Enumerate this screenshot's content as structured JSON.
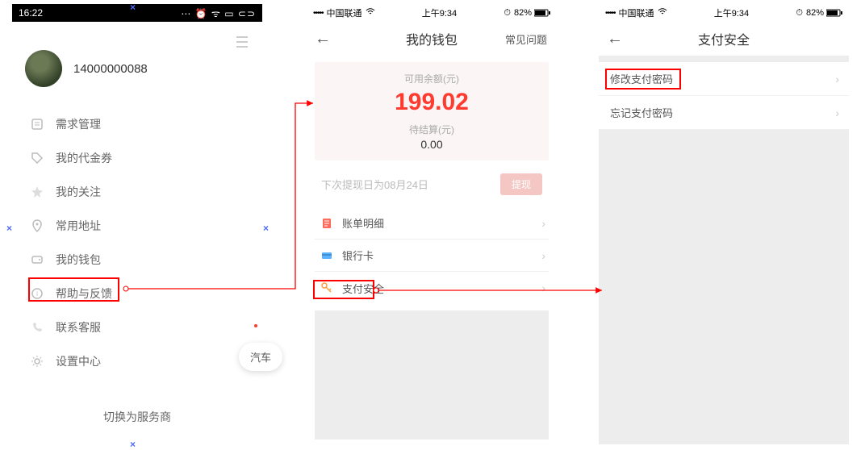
{
  "phone1": {
    "status": {
      "time": "16:22",
      "icons": "⋯ ⏰ ᯤ ▭ ⊂⊃"
    },
    "username": "14000000088",
    "menu": [
      {
        "label": "需求管理"
      },
      {
        "label": "我的代金券"
      },
      {
        "label": "我的关注"
      },
      {
        "label": "常用地址"
      },
      {
        "label": "我的钱包"
      },
      {
        "label": "帮助与反馈"
      },
      {
        "label": "联系客服"
      },
      {
        "label": "设置中心"
      }
    ],
    "switch_label": "切换为服务商",
    "pill_right": "汽车"
  },
  "phone2": {
    "status": {
      "carrier": "中国联通",
      "time": "上午9:34",
      "battery": "82%"
    },
    "title": "我的钱包",
    "faq": "常见问题",
    "avail_label": "可用余额(元)",
    "avail_value": "199.02",
    "pending_label": "待结算(元)",
    "pending_value": "0.00",
    "withdraw_note": "下次提现日为08月24日",
    "withdraw_btn": "提现",
    "cells": [
      {
        "label": "账单明细"
      },
      {
        "label": "银行卡"
      },
      {
        "label": "支付安全"
      }
    ]
  },
  "phone3": {
    "status": {
      "carrier": "中国联通",
      "time": "上午9:34",
      "battery": "82%"
    },
    "title": "支付安全",
    "cells": [
      {
        "label": "修改支付密码"
      },
      {
        "label": "忘记支付密码"
      }
    ]
  }
}
